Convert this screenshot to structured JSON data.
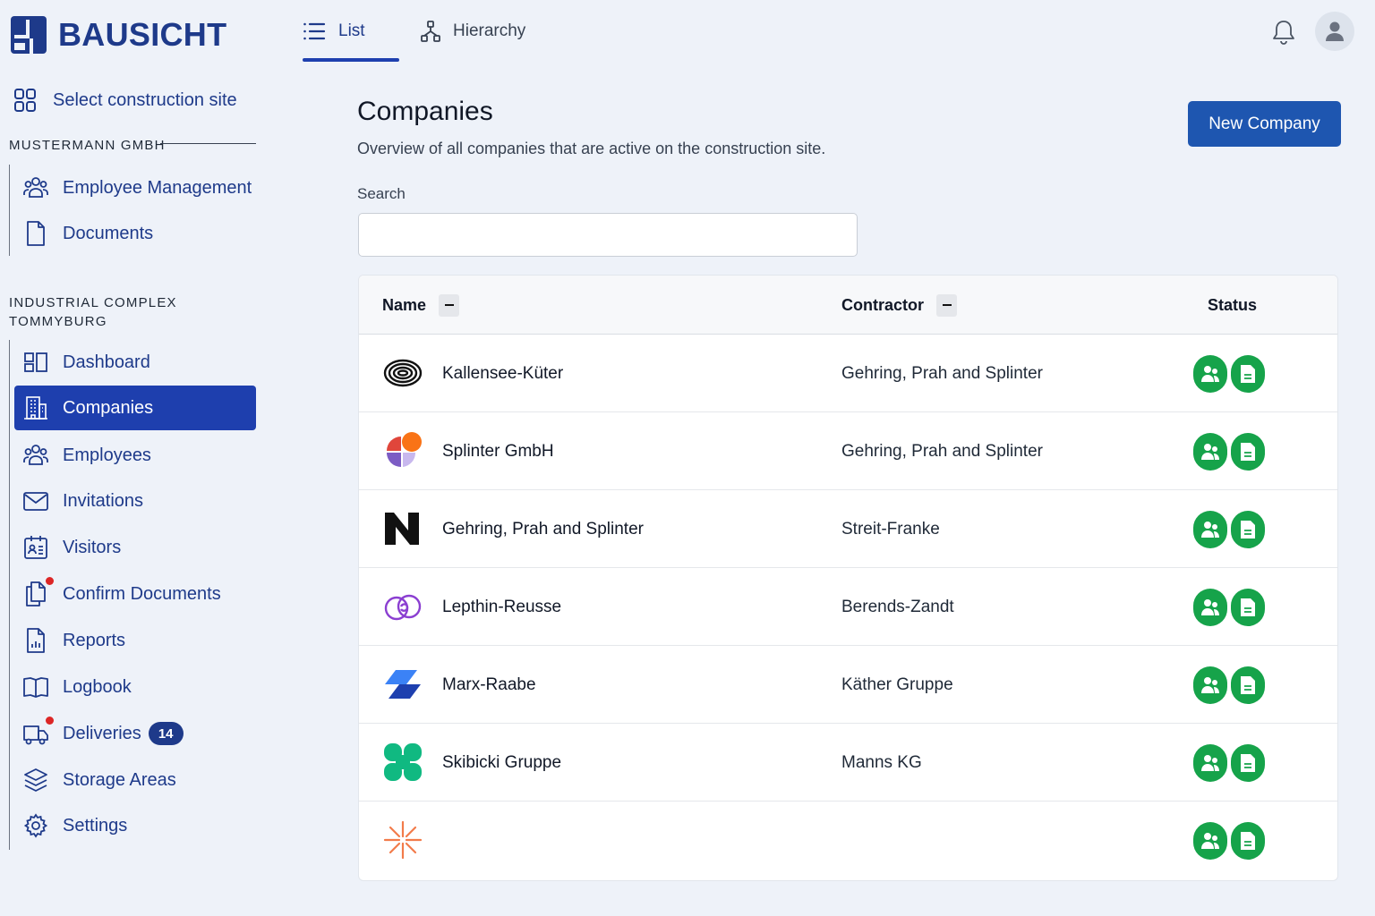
{
  "brand": {
    "name": "BAUSICHT",
    "color": "#1e3a8a"
  },
  "header": {
    "tabs": [
      {
        "label": "List",
        "icon": "list-icon",
        "active": true
      },
      {
        "label": "Hierarchy",
        "icon": "hierarchy-icon",
        "active": false
      }
    ],
    "notification_icon": "bell-icon",
    "avatar_icon": "user-icon"
  },
  "sidebar": {
    "site_select": "Select construction site",
    "groups": [
      {
        "label": "MUSTERMANN GMBH",
        "items": [
          {
            "label": "Employee Management",
            "icon": "users-icon"
          },
          {
            "label": "Documents",
            "icon": "document-icon"
          }
        ]
      },
      {
        "label": "INDUSTRIAL COMPLEX TOMMYBURG",
        "items": [
          {
            "label": "Dashboard",
            "icon": "dashboard-icon"
          },
          {
            "label": "Companies",
            "icon": "building-icon",
            "active": true
          },
          {
            "label": "Employees",
            "icon": "users-icon"
          },
          {
            "label": "Invitations",
            "icon": "mail-icon"
          },
          {
            "label": "Visitors",
            "icon": "visitor-icon"
          },
          {
            "label": "Confirm Documents",
            "icon": "documents-icon",
            "notification": true
          },
          {
            "label": "Reports",
            "icon": "report-icon"
          },
          {
            "label": "Logbook",
            "icon": "book-icon"
          },
          {
            "label": "Deliveries",
            "icon": "truck-icon",
            "notification": true,
            "badge": "14"
          },
          {
            "label": "Storage Areas",
            "icon": "layers-icon"
          },
          {
            "label": "Settings",
            "icon": "gear-icon"
          }
        ]
      }
    ]
  },
  "main": {
    "title": "Companies",
    "subtitle": "Overview of all companies that are active on the construction site.",
    "new_button": "New Company",
    "search": {
      "label": "Search",
      "value": "",
      "placeholder": ""
    },
    "table": {
      "columns": [
        "Name",
        "Contractor",
        "Status"
      ],
      "rows": [
        {
          "name": "Kallensee-Küter",
          "contractor": "Gehring, Prah and Splinter",
          "logo": "rings-logo"
        },
        {
          "name": "Splinter GmbH",
          "contractor": "Gehring, Prah and Splinter",
          "logo": "quadrant-logo"
        },
        {
          "name": "Gehring, Prah and Splinter",
          "contractor": "Streit-Franke",
          "logo": "n-logo"
        },
        {
          "name": "Lepthin-Reusse",
          "contractor": "Berends-Zandt",
          "logo": "swirl-logo"
        },
        {
          "name": "Marx-Raabe",
          "contractor": "Käther Gruppe",
          "logo": "parallelogram-logo"
        },
        {
          "name": "Skibicki Gruppe",
          "contractor": "Manns KG",
          "logo": "clover-logo"
        },
        {
          "name": "",
          "contractor": "",
          "logo": "starburst-logo"
        }
      ]
    },
    "status_icons": [
      "employees-status-icon",
      "documents-status-icon"
    ],
    "status_color": "#16a34a"
  }
}
